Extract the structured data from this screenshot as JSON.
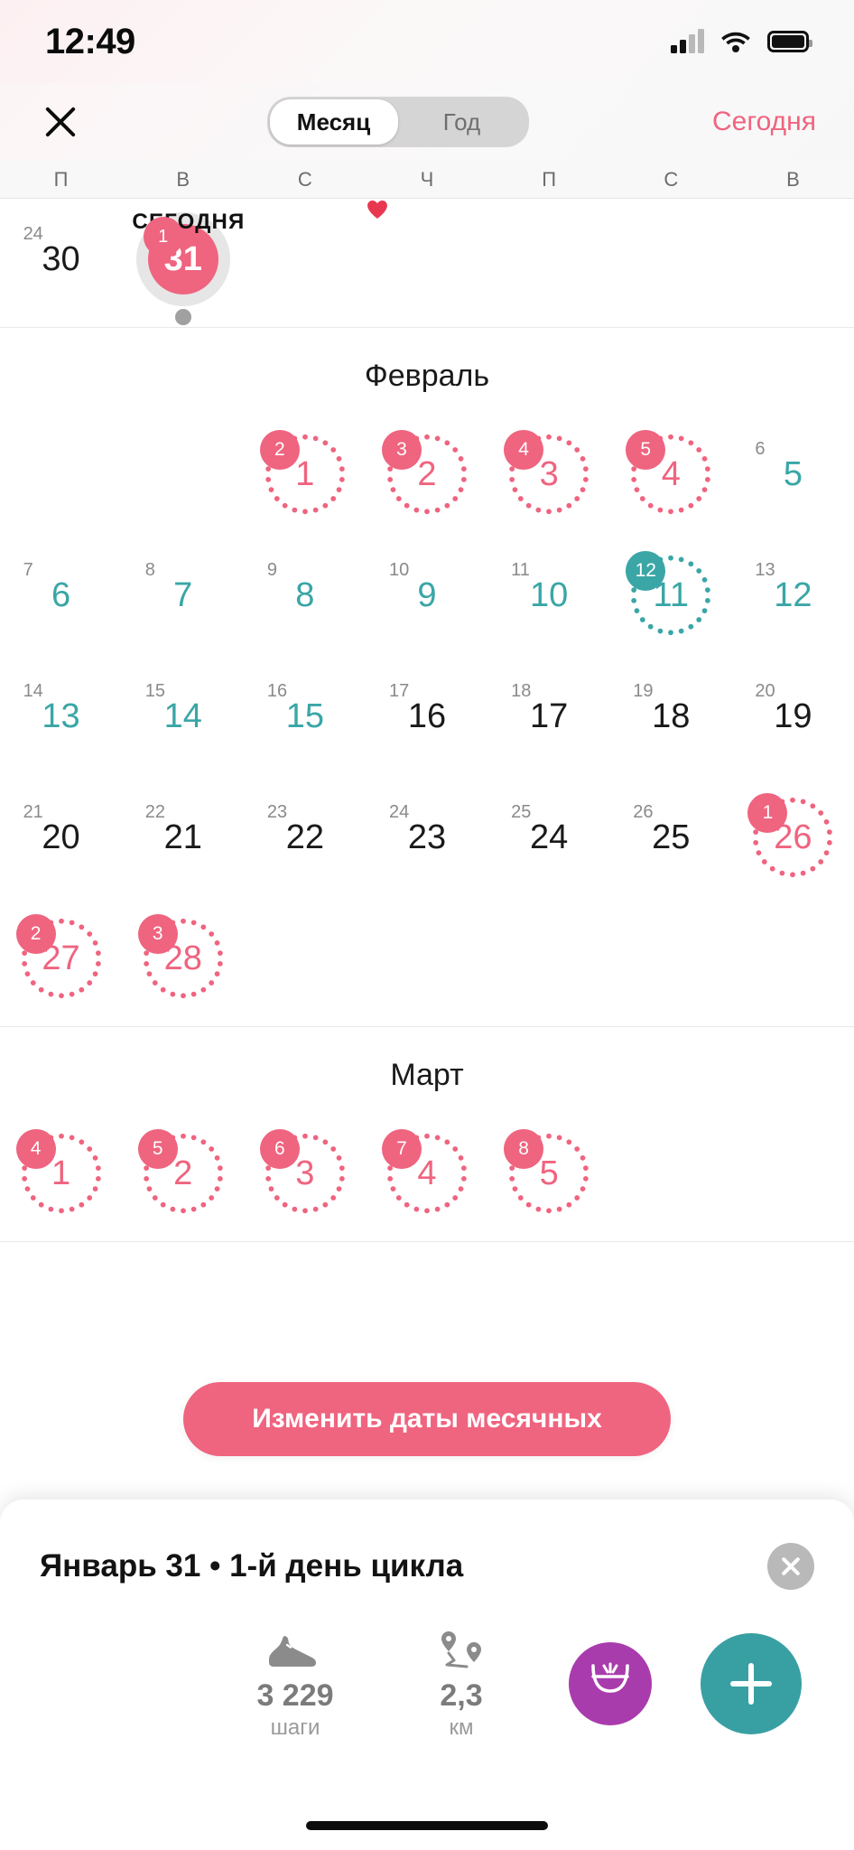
{
  "status_bar": {
    "time": "12:49",
    "signal_icon": "cellular-signal-icon",
    "wifi_icon": "wifi-icon",
    "battery_icon": "battery-icon"
  },
  "nav": {
    "close_icon": "close-icon",
    "segments": [
      {
        "label": "Месяц",
        "active": true
      },
      {
        "label": "Год",
        "active": false
      }
    ],
    "today_label": "Сегодня"
  },
  "weekdays": [
    "П",
    "В",
    "С",
    "Ч",
    "П",
    "С",
    "В"
  ],
  "colors": {
    "period": "#ef647f",
    "fertile": "#3aa6a6",
    "today_ring": "#e6e6e6",
    "muted": "#8a8a8a",
    "purple": "#a93cad",
    "teal_button": "#38a0a3"
  },
  "today_caption": "СЕГОДНЯ",
  "months": [
    {
      "name": "",
      "show_title": false,
      "weeks": [
        [
          {
            "day": "30",
            "cycle": "24",
            "state": "normal"
          },
          {
            "day": "31",
            "cycle": "1",
            "state": "today",
            "badge": "1",
            "today": true
          },
          {
            "day": "",
            "state": "empty"
          },
          {
            "day": "",
            "state": "empty"
          },
          {
            "day": "",
            "state": "empty"
          },
          {
            "day": "",
            "state": "empty"
          },
          {
            "day": "",
            "state": "empty"
          }
        ]
      ]
    },
    {
      "name": "Февраль",
      "show_title": true,
      "weeks": [
        [
          {
            "day": "",
            "state": "empty"
          },
          {
            "day": "",
            "state": "empty"
          },
          {
            "day": "1",
            "state": "period",
            "badge": "2",
            "ring": "pink"
          },
          {
            "day": "2",
            "state": "period",
            "badge": "3",
            "ring": "pink"
          },
          {
            "day": "3",
            "state": "period",
            "badge": "4",
            "ring": "pink"
          },
          {
            "day": "4",
            "state": "period",
            "badge": "5",
            "ring": "pink"
          },
          {
            "day": "5",
            "cycle": "6",
            "state": "fertile"
          }
        ],
        [
          {
            "day": "6",
            "cycle": "7",
            "state": "fertile"
          },
          {
            "day": "7",
            "cycle": "8",
            "state": "fertile"
          },
          {
            "day": "8",
            "cycle": "9",
            "state": "fertile"
          },
          {
            "day": "9",
            "cycle": "10",
            "state": "fertile"
          },
          {
            "day": "10",
            "cycle": "11",
            "state": "fertile"
          },
          {
            "day": "11",
            "state": "fertile",
            "badge": "12",
            "ring": "teal"
          },
          {
            "day": "12",
            "cycle": "13",
            "state": "fertile"
          }
        ],
        [
          {
            "day": "13",
            "cycle": "14",
            "state": "fertile"
          },
          {
            "day": "14",
            "cycle": "15",
            "state": "fertile"
          },
          {
            "day": "15",
            "cycle": "16",
            "state": "fertile"
          },
          {
            "day": "16",
            "cycle": "17",
            "state": "normal"
          },
          {
            "day": "17",
            "cycle": "18",
            "state": "normal"
          },
          {
            "day": "18",
            "cycle": "19",
            "state": "normal"
          },
          {
            "day": "19",
            "cycle": "20",
            "state": "normal"
          }
        ],
        [
          {
            "day": "20",
            "cycle": "21",
            "state": "normal"
          },
          {
            "day": "21",
            "cycle": "22",
            "state": "normal"
          },
          {
            "day": "22",
            "cycle": "23",
            "state": "normal"
          },
          {
            "day": "23",
            "cycle": "24",
            "state": "normal"
          },
          {
            "day": "24",
            "cycle": "25",
            "state": "normal"
          },
          {
            "day": "25",
            "cycle": "26",
            "state": "normal"
          },
          {
            "day": "26",
            "state": "period",
            "badge": "1",
            "ring": "pink"
          }
        ],
        [
          {
            "day": "27",
            "state": "period",
            "badge": "2",
            "ring": "pink"
          },
          {
            "day": "28",
            "state": "period",
            "badge": "3",
            "ring": "pink"
          },
          {
            "day": "",
            "state": "empty"
          },
          {
            "day": "",
            "state": "empty"
          },
          {
            "day": "",
            "state": "empty"
          },
          {
            "day": "",
            "state": "empty"
          },
          {
            "day": "",
            "state": "empty"
          }
        ]
      ]
    },
    {
      "name": "Март",
      "show_title": true,
      "weeks": [
        [
          {
            "day": "1",
            "state": "period",
            "badge": "4",
            "ring": "pink"
          },
          {
            "day": "2",
            "state": "period",
            "badge": "5",
            "ring": "pink"
          },
          {
            "day": "3",
            "state": "period",
            "badge": "6",
            "ring": "pink"
          },
          {
            "day": "4",
            "state": "period",
            "badge": "7",
            "ring": "pink"
          },
          {
            "day": "5",
            "state": "period",
            "badge": "8",
            "ring": "pink"
          },
          {
            "day": "",
            "state": "empty"
          },
          {
            "day": "",
            "state": "empty"
          }
        ]
      ]
    }
  ],
  "cta": {
    "label": "Изменить даты месячных"
  },
  "sheet": {
    "title": "Январь 31 • 1-й день цикла",
    "close_icon": "close-icon",
    "stats": [
      {
        "icon": "sneaker-icon",
        "value": "3 229",
        "unit": "шаги"
      },
      {
        "icon": "route-pin-icon",
        "value": "2,3",
        "unit": "км"
      }
    ],
    "buttons": [
      {
        "icon": "period-underwear-icon",
        "color": "#a93cad",
        "name": "log-period-button"
      },
      {
        "icon": "plus-icon",
        "color": "#38a0a3",
        "name": "add-entry-button"
      }
    ]
  }
}
